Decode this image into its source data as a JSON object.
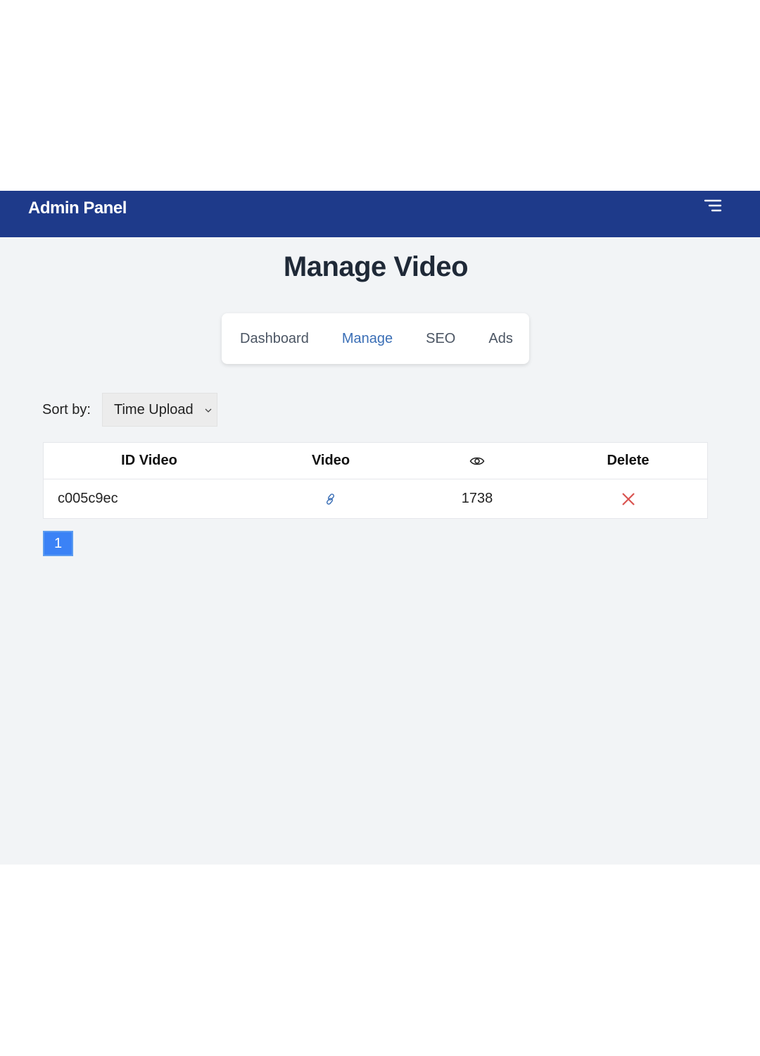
{
  "header": {
    "title": "Admin Panel",
    "menu_icon": "menu-icon"
  },
  "page": {
    "title": "Manage Video"
  },
  "tabs": [
    {
      "label": "Dashboard",
      "active": false
    },
    {
      "label": "Manage",
      "active": true
    },
    {
      "label": "SEO",
      "active": false
    },
    {
      "label": "Ads",
      "active": false
    }
  ],
  "sort": {
    "label": "Sort by:",
    "selected": "Time Upload"
  },
  "table": {
    "columns": [
      "ID Video",
      "Video",
      "eye-icon",
      "Delete"
    ],
    "rows": [
      {
        "id": "c005c9ec",
        "video": "link-icon",
        "views": "1738",
        "delete": "close-icon"
      }
    ]
  },
  "pagination": {
    "pages": [
      "1"
    ],
    "current": "1"
  },
  "colors": {
    "header": "#1e3a8a",
    "accent": "#3b82f6",
    "delete": "#d9534f",
    "link": "#3b6fb6"
  }
}
